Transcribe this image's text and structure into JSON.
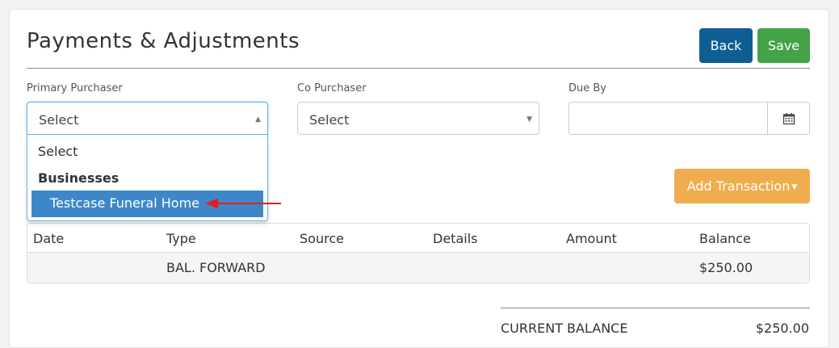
{
  "header": {
    "title": "Payments & Adjustments",
    "back_label": "Back",
    "save_label": "Save"
  },
  "colors": {
    "back": "#0e5e93",
    "save": "#44a248",
    "add": "#f0ad4e",
    "selected": "#3d87c9"
  },
  "fields": {
    "primary_purchaser": {
      "label": "Primary Purchaser",
      "value": "Select"
    },
    "co_purchaser": {
      "label": "Co Purchaser",
      "value": "Select"
    },
    "due_by": {
      "label": "Due By",
      "value": ""
    }
  },
  "dropdown": {
    "option_select": "Select",
    "group_label": "Businesses",
    "selected_option": "Testcase Funeral Home"
  },
  "add_transaction_label": "Add Transaction",
  "table": {
    "headers": [
      "Date",
      "Type",
      "Source",
      "Details",
      "Amount",
      "Balance"
    ],
    "rows": [
      {
        "date": "",
        "type": "BAL. FORWARD",
        "source": "",
        "details": "",
        "amount": "",
        "balance": "$250.00"
      }
    ]
  },
  "summary": {
    "label": "CURRENT BALANCE",
    "value": "$250.00"
  },
  "icons": {
    "calendar": "calendar-icon",
    "caret_up": "caret-up-icon",
    "caret_down": "caret-down-icon"
  }
}
